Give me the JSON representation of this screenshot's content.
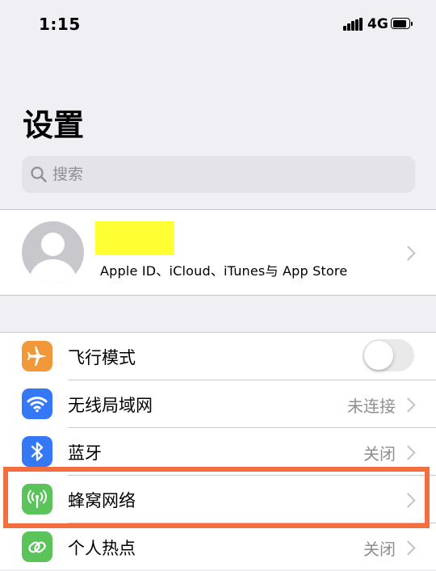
{
  "status_bar": {
    "time": "1:15",
    "network": "4G",
    "battery_level": 0.8
  },
  "page": {
    "title": "设置"
  },
  "search": {
    "placeholder": "搜索"
  },
  "profile": {
    "subtitle": "Apple ID、iCloud、iTunes与 App Store",
    "name_redaction_color": "#ffff33"
  },
  "settings": [
    {
      "label": "飞行模式",
      "icon": "airplane-icon",
      "icon_color": "#f1993a",
      "control": "toggle",
      "toggle_on": false
    },
    {
      "label": "无线局域网",
      "icon": "wifi-icon",
      "icon_color": "#3478f6",
      "value": "未连接"
    },
    {
      "label": "蓝牙",
      "icon": "bluetooth-icon",
      "icon_color": "#3478f6",
      "value": "关闭"
    },
    {
      "label": "蜂窝网络",
      "icon": "cellular-icon",
      "icon_color": "#5ac35a",
      "highlighted": true
    },
    {
      "label": "个人热点",
      "icon": "hotspot-icon",
      "icon_color": "#5ac35a",
      "value": "关闭"
    }
  ],
  "colors": {
    "highlight_border": "#f36d3f",
    "accent_blue": "#3478f6",
    "background": "#efeff4"
  }
}
